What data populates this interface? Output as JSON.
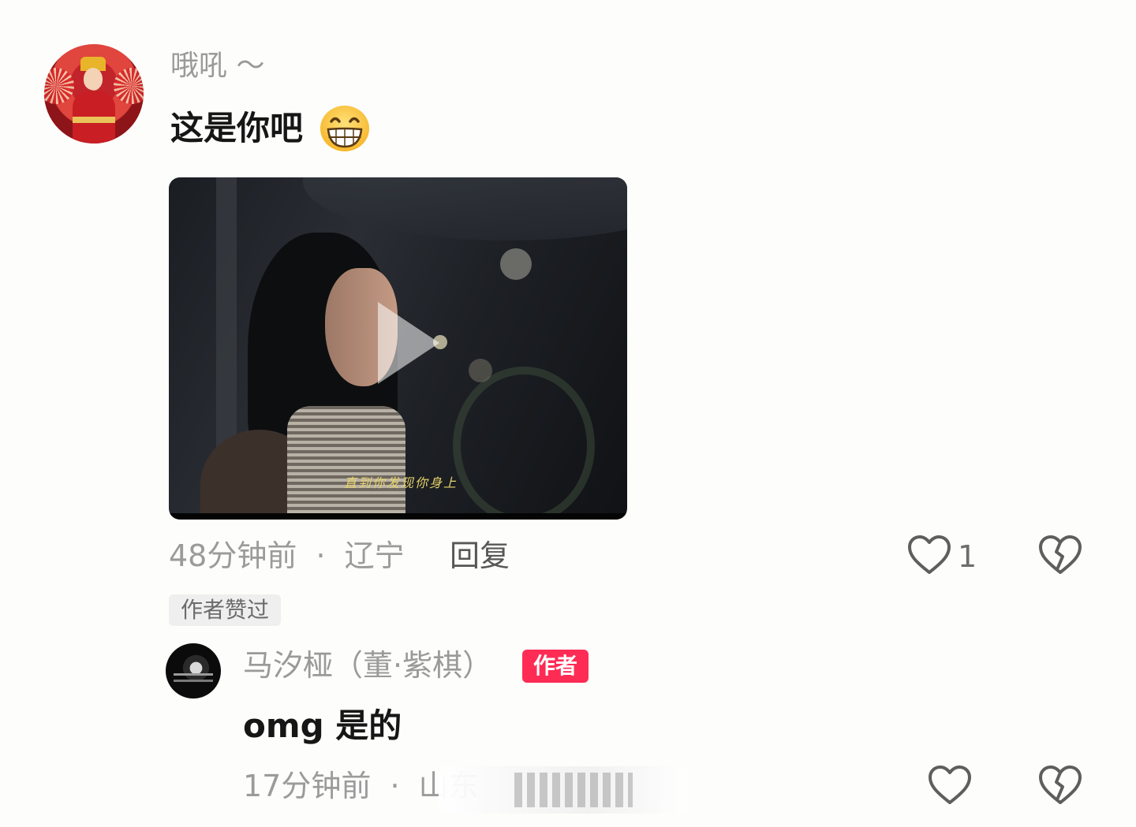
{
  "comment": {
    "username": "哦吼 ～",
    "text": "这是你吧",
    "emoji": "grinning-face-icon",
    "video": {
      "subtitle": "直到你发现你身上"
    },
    "time": "48分钟前",
    "separator": "·",
    "location": "辽宁",
    "reply_label": "回复",
    "like_count": "1",
    "author_liked_badge": "作者赞过"
  },
  "reply": {
    "username": "马汐桠（董·紫棋）",
    "author_tag": "作者",
    "text": "omg 是的",
    "time": "17分钟前",
    "separator": "·",
    "location": "山东"
  },
  "colors": {
    "author_tag": "#fe2c55",
    "muted_text": "#9b9b9b",
    "primary_text": "#161616"
  }
}
